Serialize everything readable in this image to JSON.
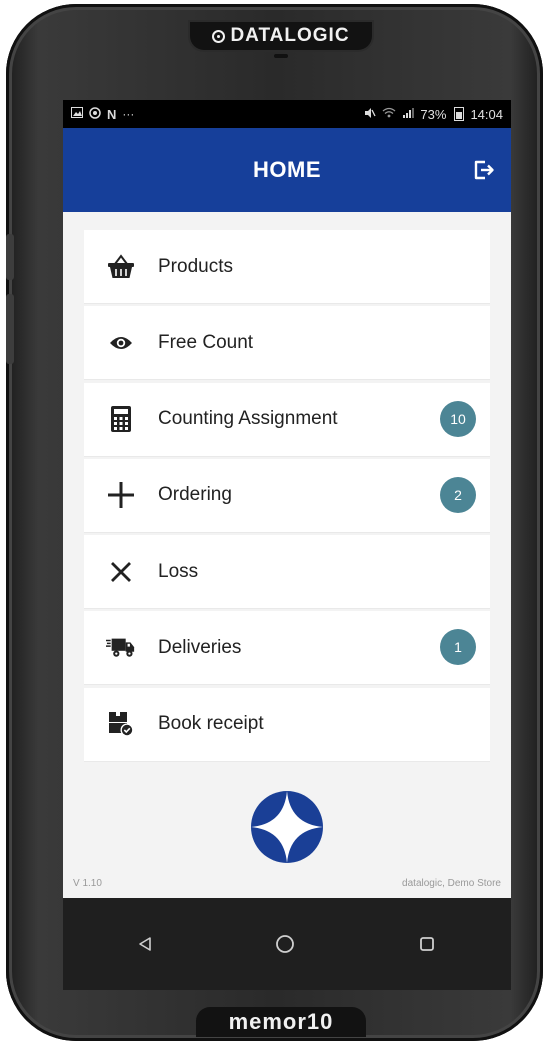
{
  "device": {
    "brand_top": "DATALOGIC",
    "brand_bottom": "memor10"
  },
  "statusbar": {
    "left_icons": [
      "image-icon",
      "target-icon",
      "n-icon",
      "more-icon"
    ],
    "more_text": "···",
    "n_text": "N",
    "battery": "73%",
    "time": "14:04"
  },
  "appbar": {
    "title": "HOME",
    "logout_icon": "logout-icon"
  },
  "menu": [
    {
      "label": "Products",
      "icon": "basket-icon",
      "badge": ""
    },
    {
      "label": "Free Count",
      "icon": "eye-icon",
      "badge": ""
    },
    {
      "label": "Counting Assignment",
      "icon": "calculator-icon",
      "badge": "10"
    },
    {
      "label": "Ordering",
      "icon": "plus-icon",
      "badge": "2"
    },
    {
      "label": "Loss",
      "icon": "close-icon",
      "badge": ""
    },
    {
      "label": "Deliveries",
      "icon": "truck-icon",
      "badge": "1"
    },
    {
      "label": "Book receipt",
      "icon": "box-check-icon",
      "badge": ""
    }
  ],
  "footer": {
    "version": "V 1.10",
    "store": "datalogic, Demo Store"
  },
  "colors": {
    "appbar": "#163f9a",
    "badge": "#4c8595",
    "logo": "#1a3f96"
  }
}
